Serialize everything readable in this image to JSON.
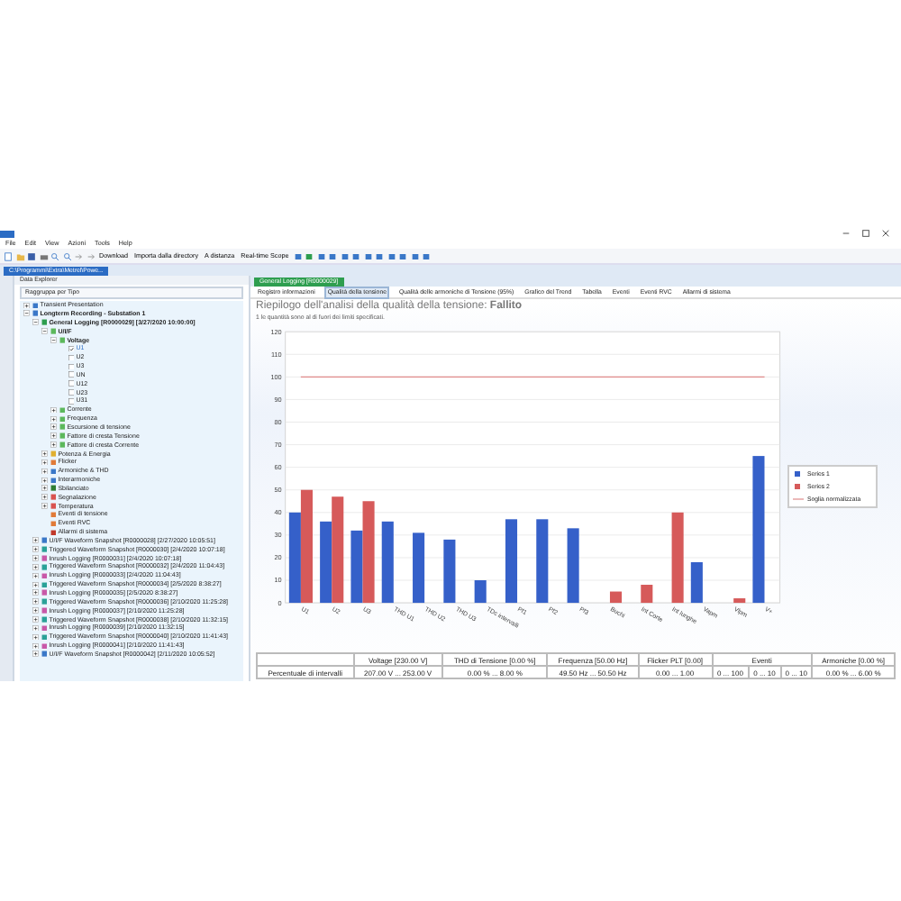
{
  "menu": [
    "File",
    "Edit",
    "View",
    "Azioni",
    "Tools",
    "Help"
  ],
  "toolbar": {
    "buttons": [
      "Download",
      "Importa dalla directory",
      "A distanza",
      "Real-time Scope"
    ]
  },
  "doc_tab": {
    "title": "C:\\Programmi\\Extra\\Metrel\\Powe..."
  },
  "explorer": {
    "title": "Data Explorer",
    "group_by": "Raggruppa per Tipo",
    "tree": [
      {
        "label": "Transient Presentation",
        "expanded": false,
        "color": "#3a78c8"
      },
      {
        "label": "Longterm Recording - Substation 1",
        "expanded": true,
        "color": "#3a78c8",
        "children": [
          {
            "label": "General Logging [R0000029] [3/27/2020 10:00:00]",
            "expanded": true,
            "color": "#2e9e4f",
            "children": [
              {
                "label": "U/I/F",
                "expanded": true,
                "color": "#5cb85c",
                "children": [
                  {
                    "label": "Voltage",
                    "expanded": true,
                    "color": "#5cb85c",
                    "children": [
                      {
                        "label": "U1",
                        "kind": "checkbox",
                        "checked": true
                      },
                      {
                        "label": "U2",
                        "kind": "checkbox",
                        "checked": false
                      },
                      {
                        "label": "U3",
                        "kind": "checkbox",
                        "checked": false
                      },
                      {
                        "label": "UN",
                        "kind": "checkbox",
                        "checked": false
                      },
                      {
                        "label": "U12",
                        "kind": "checkbox",
                        "checked": false
                      },
                      {
                        "label": "U23",
                        "kind": "checkbox",
                        "checked": false
                      },
                      {
                        "label": "U31",
                        "kind": "checkbox",
                        "checked": false
                      }
                    ]
                  },
                  {
                    "label": "Corrente",
                    "expanded": false,
                    "color": "#5cb85c"
                  },
                  {
                    "label": "Frequenza",
                    "expanded": false,
                    "color": "#5cb85c"
                  },
                  {
                    "label": "Escursione di tensione",
                    "expanded": false,
                    "color": "#5cb85c"
                  },
                  {
                    "label": "Fattore di cresta Tensione",
                    "expanded": false,
                    "color": "#5cb85c"
                  },
                  {
                    "label": "Fattore di cresta Corrente",
                    "expanded": false,
                    "color": "#5cb85c"
                  }
                ]
              },
              {
                "label": "Potenza & Energia",
                "expanded": false,
                "color": "#e0b030"
              },
              {
                "label": "Flicker",
                "expanded": false,
                "color": "#e07b39"
              },
              {
                "label": "Armoniche & THD",
                "expanded": false,
                "color": "#3a78c8"
              },
              {
                "label": "Interarmoniche",
                "expanded": false,
                "color": "#3a78c8"
              },
              {
                "label": "Sbilanciato",
                "expanded": false,
                "color": "#2e7d32"
              },
              {
                "label": "Segnalazione",
                "expanded": false,
                "color": "#d9534f"
              },
              {
                "label": "Temperatura",
                "expanded": false,
                "color": "#d9534f"
              },
              {
                "label": "Eventi di tensione",
                "color": "#e07b39"
              },
              {
                "label": "Eventi RVC",
                "color": "#e07b39"
              },
              {
                "label": "Allarmi di sistema",
                "color": "#c0392b"
              }
            ]
          },
          {
            "label": "U/I/F Waveform Snapshot [R0000028] [2/27/2020 10:05:51]",
            "expanded": false,
            "color": "#3a78c8"
          },
          {
            "label": "Triggered Waveform Snapshot [R0000030] [2/4/2020 10:07:18]",
            "expanded": false,
            "color": "#2aa198"
          },
          {
            "label": "Inrush Logging [R0000031] [2/4/2020 10:07:18]",
            "expanded": false,
            "color": "#c858a8"
          },
          {
            "label": "Triggered Waveform Snapshot [R0000032] [2/4/2020 11:04:43]",
            "expanded": false,
            "color": "#2aa198"
          },
          {
            "label": "Inrush Logging [R0000033] [2/4/2020 11:04:43]",
            "expanded": false,
            "color": "#c858a8"
          },
          {
            "label": "Triggered Waveform Snapshot [R0000034] [2/5/2020 8:38:27]",
            "expanded": false,
            "color": "#2aa198"
          },
          {
            "label": "Inrush Logging [R0000035] [2/5/2020 8:38:27]",
            "expanded": false,
            "color": "#c858a8"
          },
          {
            "label": "Triggered Waveform Snapshot [R0000036] [2/10/2020 11:25:28]",
            "expanded": false,
            "color": "#2aa198"
          },
          {
            "label": "Inrush Logging [R0000037] [2/10/2020 11:25:28]",
            "expanded": false,
            "color": "#c858a8"
          },
          {
            "label": "Triggered Waveform Snapshot [R0000038] [2/10/2020 11:32:15]",
            "expanded": false,
            "color": "#2aa198"
          },
          {
            "label": "Inrush Logging [R0000039] [2/10/2020 11:32:15]",
            "expanded": false,
            "color": "#c858a8"
          },
          {
            "label": "Triggered Waveform Snapshot [R0000040] [2/10/2020 11:41:43]",
            "expanded": false,
            "color": "#2aa198"
          },
          {
            "label": "Inrush Logging [R0000041] [2/10/2020 11:41:43]",
            "expanded": false,
            "color": "#c858a8"
          },
          {
            "label": "U/I/F Waveform Snapshot [R0000042] [2/11/2020 10:05:52]",
            "expanded": false,
            "color": "#3a78c8"
          }
        ]
      }
    ]
  },
  "document": {
    "tab": "General Logging [R0000029]",
    "subtabs": [
      {
        "label": "Registro informazioni",
        "selected": false
      },
      {
        "label": "Qualità della tensione",
        "selected": true
      },
      {
        "label": "Qualità delle armoniche di Tensione (95%)",
        "selected": false
      },
      {
        "label": "Grafico del Trend",
        "selected": false
      },
      {
        "label": "Tabella",
        "selected": false
      },
      {
        "label": "Eventi",
        "selected": false
      },
      {
        "label": "Eventi RVC",
        "selected": false
      },
      {
        "label": "Allarmi di sistema",
        "selected": false
      }
    ],
    "title": "Riepilogo dell'analisi della qualità della tensione: **Fallito**",
    "subtitle": "1 le quantità sono al di fuori dei limiti specificati.",
    "chart_data": {
      "type": "bar",
      "categories": [
        "U1",
        "U2",
        "U3",
        "THD U1",
        "THD U2",
        "THD U3",
        "TDc intervalli",
        "Pf1",
        "Pf2",
        "Pf3",
        "Buchi",
        "Int Corte",
        "Int lunghe",
        "Vapm",
        "Vlpm",
        "V+"
      ],
      "series": [
        {
          "name": "Series 1",
          "color": "#3560c9",
          "values": [
            40,
            36,
            32,
            36,
            31,
            28,
            10,
            37,
            37,
            33,
            null,
            null,
            null,
            18,
            null,
            65
          ]
        },
        {
          "name": "Series 2",
          "color": "#d65a5a",
          "values": [
            50,
            47,
            45,
            null,
            null,
            null,
            null,
            null,
            null,
            null,
            5,
            8,
            40,
            null,
            2,
            null
          ]
        },
        {
          "name": "Soglia normalizzata",
          "type": "line",
          "color": "#e08a8a",
          "values": [
            100,
            100,
            100,
            100,
            100,
            100,
            100,
            100,
            100,
            100,
            100,
            100,
            100,
            100,
            100,
            100
          ]
        }
      ],
      "ylim": [
        0,
        120
      ],
      "grid": true,
      "yticks": [
        0,
        10,
        20,
        30,
        40,
        50,
        60,
        70,
        80,
        90,
        100,
        110,
        120
      ]
    },
    "table": {
      "header": [
        "Voltage [230.00 V]",
        "THD di Tensione [0.00 %]",
        "Frequenza [50.00 Hz]",
        "Flicker PLT [0.00]",
        "Eventi",
        "Armoniche [0.00 %]"
      ],
      "row_label": "Percentuale di intervalli",
      "cells": [
        "207.00 V ... 253.00 V",
        "0.00 % ... 8.00 %",
        "49.50 Hz ... 50.50 Hz",
        "0.00 ... 1.00",
        "0 ... 100",
        "0 ... 10",
        "0 ... 10",
        "0.00 % ... 6.00 %"
      ]
    }
  }
}
